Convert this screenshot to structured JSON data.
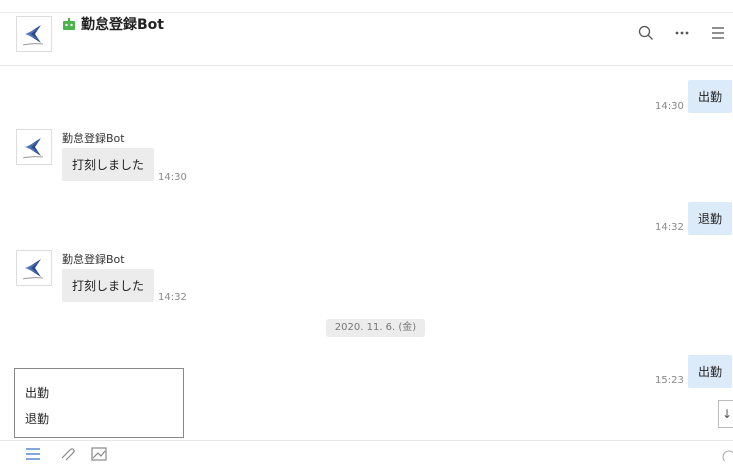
{
  "header": {
    "title": "勤怠登録Bot",
    "icons": [
      "robot-icon",
      "search-icon",
      "more-icon",
      "menu-icon"
    ],
    "accent_color": "#4cb34a"
  },
  "messages": [
    {
      "type": "outgoing",
      "text": "出勤",
      "time": "14:30"
    },
    {
      "type": "incoming",
      "sender": "勤怠登録Bot",
      "text": "打刻しました",
      "time": "14:30"
    },
    {
      "type": "outgoing",
      "text": "退勤",
      "time": "14:32"
    },
    {
      "type": "incoming",
      "sender": "勤怠登録Bot",
      "text": "打刻しました",
      "time": "14:32"
    },
    {
      "type": "outgoing",
      "text": "出勤",
      "time": "15:23"
    }
  ],
  "date_separator": "2020. 11. 6. (金)",
  "quick_reply": {
    "options": [
      "出勤",
      "退勤"
    ]
  },
  "scroll_button": "↓",
  "toolbar": {
    "icons": [
      "list-icon",
      "attachment-icon",
      "image-icon",
      "emoji-icon"
    ]
  }
}
